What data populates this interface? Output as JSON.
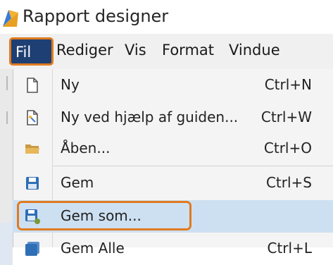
{
  "window": {
    "title": "Rapport designer",
    "icon": "report-designer-icon"
  },
  "menubar": {
    "items": [
      {
        "label": "Fil",
        "active": true
      },
      {
        "label": "Rediger"
      },
      {
        "label": "Vis"
      },
      {
        "label": "Format"
      },
      {
        "label": "Vindue"
      }
    ]
  },
  "file_menu": {
    "items": [
      {
        "label": "Ny",
        "shortcut": "Ctrl+N",
        "icon": "new-document-icon"
      },
      {
        "label": "Ny ved hjælp af guiden...",
        "shortcut": "Ctrl+W",
        "icon": "wizard-document-icon"
      },
      {
        "label": "Åben...",
        "shortcut": "Ctrl+O",
        "icon": "folder-open-icon"
      },
      {
        "label": "Gem",
        "shortcut": "Ctrl+S",
        "icon": "save-icon"
      },
      {
        "label": "Gem som...",
        "shortcut": "",
        "icon": "save-as-icon",
        "highlighted": true
      },
      {
        "label": "Gem Alle",
        "shortcut": "Ctrl+L",
        "icon": "save-all-icon"
      }
    ]
  },
  "colors": {
    "highlight": "#cde0f2",
    "callout": "#e07a1f",
    "active_menu": "#1e3f73"
  }
}
